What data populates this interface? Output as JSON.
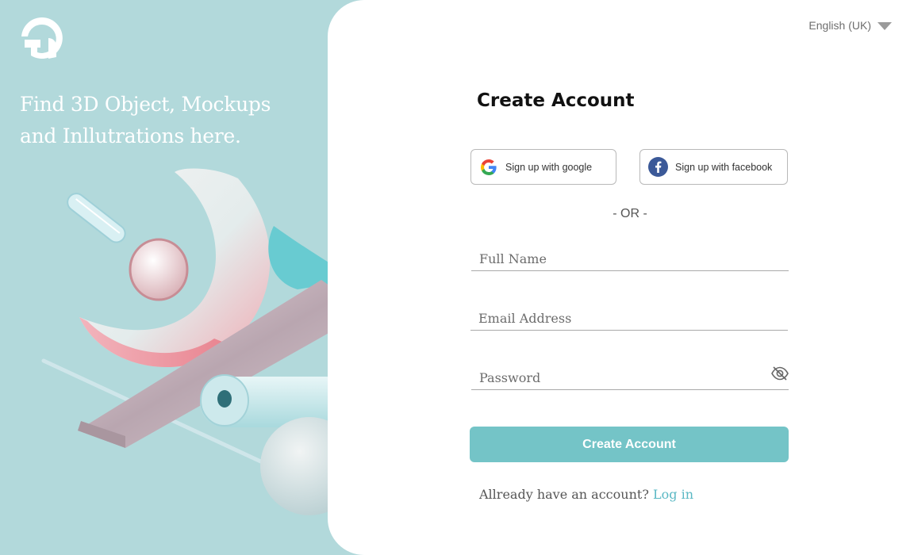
{
  "hero": {
    "tagline_line1": "Find 3D Object, Mockups",
    "tagline_line2": "and Inllutrations here."
  },
  "language": {
    "selected": "English (UK)"
  },
  "form": {
    "title": "Create Account",
    "google_label": "Sign up with google",
    "facebook_label": "Sign up with facebook",
    "or_text": "- OR -",
    "full_name_placeholder": "Full Name",
    "email_placeholder": "Email Address",
    "password_placeholder": "Password",
    "submit_label": "Create Account",
    "login_prompt": "Allready have an account?",
    "login_link": "Log in"
  },
  "colors": {
    "hero_bg": "#b2d9db",
    "accent": "#74c4c7",
    "link": "#5ab8c4"
  }
}
